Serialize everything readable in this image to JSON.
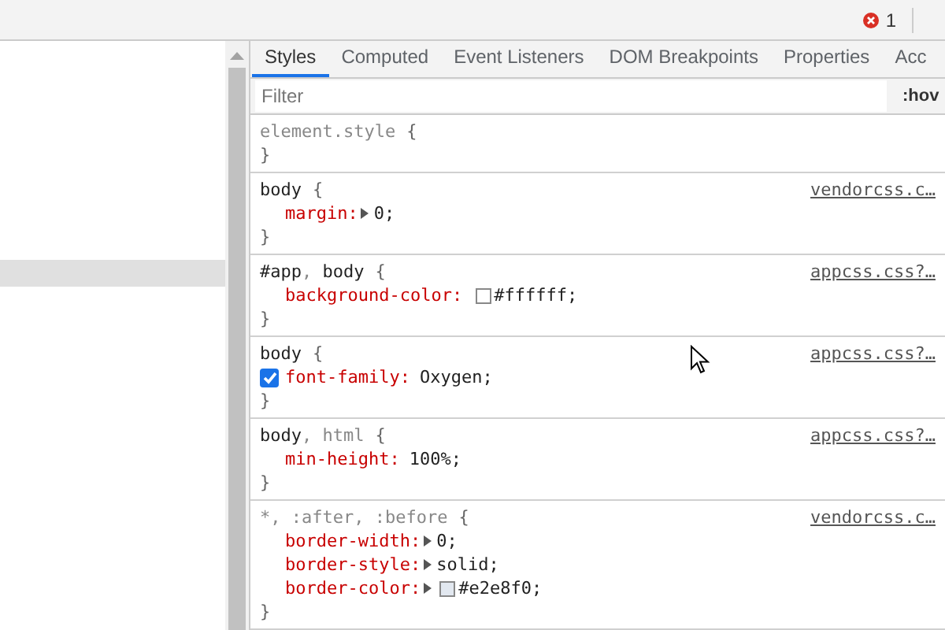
{
  "toolbar": {
    "error_count": "1"
  },
  "tabs": [
    {
      "label": "Styles",
      "selected": true
    },
    {
      "label": "Computed",
      "selected": false
    },
    {
      "label": "Event Listeners",
      "selected": false
    },
    {
      "label": "DOM Breakpoints",
      "selected": false
    },
    {
      "label": "Properties",
      "selected": false
    },
    {
      "label": "Acc",
      "selected": false
    }
  ],
  "filter": {
    "placeholder": "Filter",
    "hover_toggle": ":hov"
  },
  "rules": [
    {
      "selector": [
        {
          "text": "element.style",
          "matched": false
        }
      ],
      "brace_open": "{",
      "brace_close": "}"
    },
    {
      "selector": [
        {
          "text": "body",
          "matched": true
        }
      ],
      "brace_open": "{",
      "brace_close": "}",
      "source": "vendorcss.c…",
      "properties": [
        {
          "name": "margin:",
          "value": "0;",
          "expandable": true
        }
      ]
    },
    {
      "selector": [
        {
          "text": "#app",
          "matched": true
        },
        {
          "text": ", ",
          "matched": false
        },
        {
          "text": "body",
          "matched": true
        }
      ],
      "brace_open": "{",
      "brace_close": "}",
      "source": "appcss.css?…",
      "properties": [
        {
          "name": "background-color:",
          "value": "#ffffff;",
          "swatch": true
        }
      ]
    },
    {
      "selector": [
        {
          "text": "body",
          "matched": true
        }
      ],
      "brace_open": "{",
      "brace_close": "}",
      "source": "appcss.css?…",
      "properties": [
        {
          "name": "font-family:",
          "value": "Oxygen;",
          "checked": true
        }
      ]
    },
    {
      "selector": [
        {
          "text": "body",
          "matched": true
        },
        {
          "text": ", html",
          "matched": false
        }
      ],
      "brace_open": "{",
      "brace_close": "}",
      "source": "appcss.css?…",
      "properties": [
        {
          "name": "min-height:",
          "value": "100%;"
        }
      ]
    },
    {
      "selector": [
        {
          "text": "*, :after, :before",
          "matched": false
        }
      ],
      "brace_open": "{",
      "brace_close": "}",
      "source": "vendorcss.c…",
      "properties": [
        {
          "name": "border-width:",
          "value": "0;",
          "expandable": true
        },
        {
          "name": "border-style:",
          "value": "solid;",
          "expandable": true
        },
        {
          "name": "border-color:",
          "value": "#e2e8f0;",
          "expandable": true,
          "swatch": true
        }
      ]
    }
  ]
}
